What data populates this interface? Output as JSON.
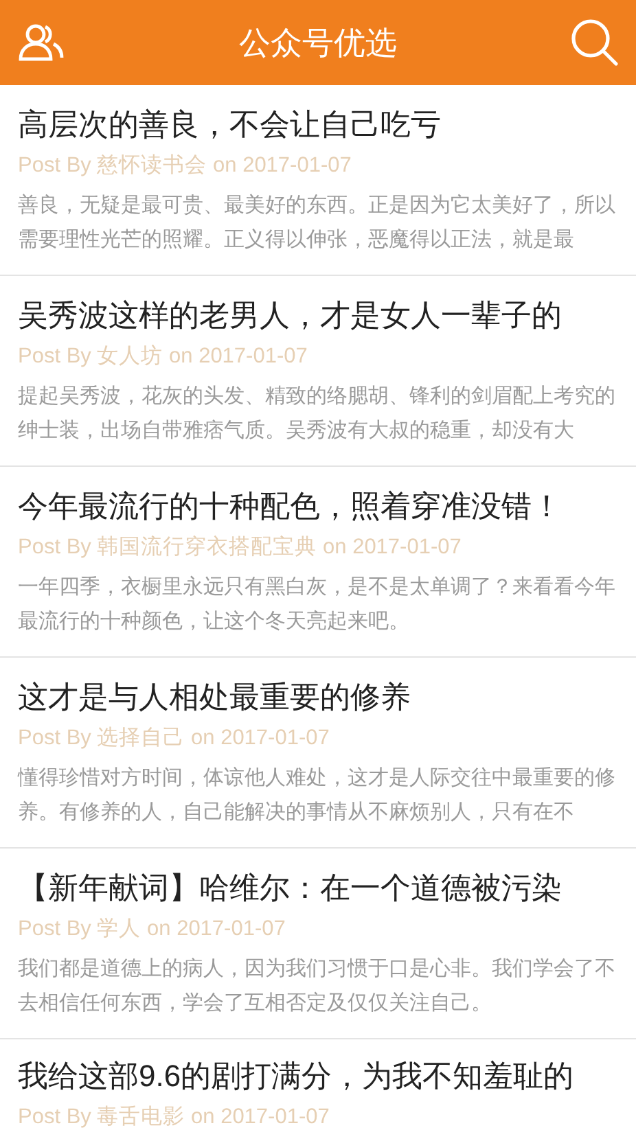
{
  "header": {
    "title": "公众号优选"
  },
  "posts": [
    {
      "title": "高层次的善良，不会让自己吃亏",
      "prefix": "Post By",
      "author": "慈怀读书会",
      "on": "on",
      "date": "2017-01-07",
      "summary": "善良，无疑是最可贵、最美好的东西。正是因为它太美好了，所以需要理性光芒的照耀。正义得以伸张，恶魔得以正法，就是最"
    },
    {
      "title": "吴秀波这样的老男人，才是女人一辈子的",
      "prefix": "Post By",
      "author": "女人坊",
      "on": "on",
      "date": "2017-01-07",
      "summary": "提起吴秀波，花灰的头发、精致的络腮胡、锋利的剑眉配上考究的绅士装，出场自带雅痞气质。吴秀波有大叔的稳重，却没有大"
    },
    {
      "title": "今年最流行的十种配色，照着穿准没错！",
      "prefix": "Post By",
      "author": "韩国流行穿衣搭配宝典",
      "on": "on",
      "date": "2017-01-07",
      "summary": "一年四季，衣橱里永远只有黑白灰，是不是太单调了？来看看今年最流行的十种颜色，让这个冬天亮起来吧。"
    },
    {
      "title": "这才是与人相处最重要的修养",
      "prefix": "Post By",
      "author": "选择自己",
      "on": "on",
      "date": "2017-01-07",
      "summary": "懂得珍惜对方时间，体谅他人难处，这才是人际交往中最重要的修养。有修养的人，自己能解决的事情从不麻烦别人，只有在不"
    },
    {
      "title": "【新年献词】哈维尔：在一个道德被污染",
      "prefix": "Post By",
      "author": "学人",
      "on": "on",
      "date": "2017-01-07",
      "summary": "我们都是道德上的病人，因为我们习惯于口是心非。我们学会了不去相信任何东西，学会了互相否定及仅仅关注自己。"
    },
    {
      "title": "我给这部9.6的剧打满分，为我不知羞耻的",
      "prefix": "Post By",
      "author": "毒舌电影",
      "on": "on",
      "date": "2017-01-07"
    }
  ]
}
